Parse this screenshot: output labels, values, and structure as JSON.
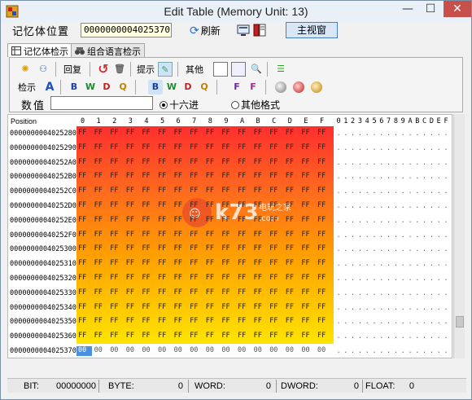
{
  "window": {
    "title": "Edit Table (Memory Unit: 13)",
    "min_glyph": "—",
    "max_glyph": "☐",
    "close_glyph": "✕"
  },
  "address": {
    "label": "记忆体位置",
    "value": "0000000004025370",
    "refresh_label": "刷新",
    "main_view_label": "主视窗"
  },
  "tabs": [
    {
      "label": "记忆体检示",
      "active": true
    },
    {
      "label": "组合语言检示",
      "active": false
    }
  ],
  "toolbar": {
    "restore_label": "回复",
    "hint_label": "提示",
    "other_label": "其他",
    "view_label": "检示"
  },
  "value_row": {
    "label": "数值",
    "input_value": "",
    "radio_hex": "十六进",
    "radio_other": "其他格式",
    "hex_selected": true
  },
  "grid": {
    "position_header": "Position",
    "hex_headers": [
      "0",
      "1",
      "2",
      "3",
      "4",
      "5",
      "6",
      "7",
      "8",
      "9",
      "A",
      "B",
      "C",
      "D",
      "E",
      "F"
    ],
    "ascii_headers": [
      "0",
      "1",
      "2",
      "3",
      "4",
      "5",
      "6",
      "7",
      "8",
      "9",
      "A",
      "B",
      "C",
      "D",
      "E",
      "F"
    ],
    "rows": [
      {
        "addr": "0000000004025280",
        "cells": [
          "FF",
          "FF",
          "FF",
          "FF",
          "FF",
          "FF",
          "FF",
          "FF",
          "FF",
          "FF",
          "FF",
          "FF",
          "FF",
          "FF",
          "FF",
          "FF"
        ]
      },
      {
        "addr": "0000000004025290",
        "cells": [
          "FF",
          "FF",
          "FF",
          "FF",
          "FF",
          "FF",
          "FF",
          "FF",
          "FF",
          "FF",
          "FF",
          "FF",
          "FF",
          "FF",
          "FF",
          "FF"
        ]
      },
      {
        "addr": "00000000040252A0",
        "cells": [
          "FF",
          "FF",
          "FF",
          "FF",
          "FF",
          "FF",
          "FF",
          "FF",
          "FF",
          "FF",
          "FF",
          "FF",
          "FF",
          "FF",
          "FF",
          "FF"
        ]
      },
      {
        "addr": "00000000040252B0",
        "cells": [
          "FF",
          "FF",
          "FF",
          "FF",
          "FF",
          "FF",
          "FF",
          "FF",
          "FF",
          "FF",
          "FF",
          "FF",
          "FF",
          "FF",
          "FF",
          "FF"
        ]
      },
      {
        "addr": "00000000040252C0",
        "cells": [
          "FF",
          "FF",
          "FF",
          "FF",
          "FF",
          "FF",
          "FF",
          "FF",
          "FF",
          "FF",
          "FF",
          "FF",
          "FF",
          "FF",
          "FF",
          "FF"
        ]
      },
      {
        "addr": "00000000040252D0",
        "cells": [
          "FF",
          "FF",
          "FF",
          "FF",
          "FF",
          "FF",
          "FF",
          "FF",
          "FF",
          "FF",
          "FF",
          "FF",
          "FF",
          "FF",
          "FF",
          "FF"
        ]
      },
      {
        "addr": "00000000040252E0",
        "cells": [
          "FF",
          "FF",
          "FF",
          "FF",
          "FF",
          "FF",
          "FF",
          "FF",
          "FF",
          "FF",
          "FF",
          "FF",
          "FF",
          "FF",
          "FF",
          "FF"
        ]
      },
      {
        "addr": "00000000040252F0",
        "cells": [
          "FF",
          "FF",
          "FF",
          "FF",
          "FF",
          "FF",
          "FF",
          "FF",
          "FF",
          "FF",
          "FF",
          "FF",
          "FF",
          "FF",
          "FF",
          "FF"
        ]
      },
      {
        "addr": "0000000004025300",
        "cells": [
          "FF",
          "FF",
          "FF",
          "FF",
          "FF",
          "FF",
          "FF",
          "FF",
          "FF",
          "FF",
          "FF",
          "FF",
          "FF",
          "FF",
          "FF",
          "FF"
        ]
      },
      {
        "addr": "0000000004025310",
        "cells": [
          "FF",
          "FF",
          "FF",
          "FF",
          "FF",
          "FF",
          "FF",
          "FF",
          "FF",
          "FF",
          "FF",
          "FF",
          "FF",
          "FF",
          "FF",
          "FF"
        ]
      },
      {
        "addr": "0000000004025320",
        "cells": [
          "FF",
          "FF",
          "FF",
          "FF",
          "FF",
          "FF",
          "FF",
          "FF",
          "FF",
          "FF",
          "FF",
          "FF",
          "FF",
          "FF",
          "FF",
          "FF"
        ]
      },
      {
        "addr": "0000000004025330",
        "cells": [
          "FF",
          "FF",
          "FF",
          "FF",
          "FF",
          "FF",
          "FF",
          "FF",
          "FF",
          "FF",
          "FF",
          "FF",
          "FF",
          "FF",
          "FF",
          "FF"
        ]
      },
      {
        "addr": "0000000004025340",
        "cells": [
          "FF",
          "FF",
          "FF",
          "FF",
          "FF",
          "FF",
          "FF",
          "FF",
          "FF",
          "FF",
          "FF",
          "FF",
          "FF",
          "FF",
          "FF",
          "FF"
        ]
      },
      {
        "addr": "0000000004025350",
        "cells": [
          "FF",
          "FF",
          "FF",
          "FF",
          "FF",
          "FF",
          "FF",
          "FF",
          "FF",
          "FF",
          "FF",
          "FF",
          "FF",
          "FF",
          "FF",
          "FF"
        ]
      },
      {
        "addr": "0000000004025360",
        "cells": [
          "FF",
          "FF",
          "FF",
          "FF",
          "FF",
          "FF",
          "FF",
          "FF",
          "FF",
          "FF",
          "FF",
          "FF",
          "FF",
          "FF",
          "FF",
          "FF"
        ]
      },
      {
        "addr": "0000000004025370",
        "cells": [
          "00",
          "00",
          "00",
          "00",
          "00",
          "00",
          "00",
          "00",
          "00",
          "00",
          "00",
          "00",
          "00",
          "00",
          "00",
          "00"
        ]
      }
    ],
    "ascii_char": ".",
    "gradient_colors": [
      "#ff2e2e",
      "#ff6a1e",
      "#ffa000",
      "#ffe400"
    ],
    "selection_color": "#4a90e2"
  },
  "watermark": {
    "text": "k73",
    "subtext": "电玩之家",
    "domain": ".com"
  },
  "status": {
    "bit_label": "BIT:",
    "bit_value": "00000000",
    "byte_label": "BYTE:",
    "byte_value": "0",
    "word_label": "WORD:",
    "word_value": "0",
    "dword_label": "DWORD:",
    "dword_value": "0",
    "float_label": "FLOAT:",
    "float_value": "0"
  }
}
